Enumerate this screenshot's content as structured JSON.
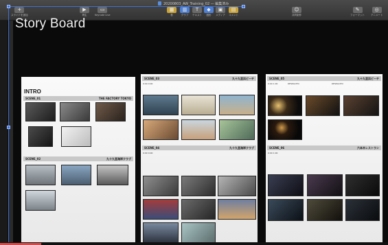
{
  "window": {
    "title": "20200803_AW_Training_02 — 編集済み"
  },
  "toolbar": {
    "left": [
      {
        "id": "view",
        "label": "スライドを追加"
      },
      {
        "id": "play",
        "label": "再生"
      },
      {
        "id": "keynote-live",
        "label": "Keynote Live"
      }
    ],
    "center": [
      {
        "id": "table",
        "label": "表"
      },
      {
        "id": "chart",
        "label": "グラフ"
      },
      {
        "id": "text",
        "label": "テキスト"
      },
      {
        "id": "shape",
        "label": "図形"
      },
      {
        "id": "media",
        "label": "メディア"
      },
      {
        "id": "comment",
        "label": "コメント"
      }
    ],
    "right": [
      {
        "id": "collab",
        "label": "共同制作"
      },
      {
        "id": "format",
        "label": "フォーマット"
      },
      {
        "id": "animate",
        "label": "アニメート"
      }
    ]
  },
  "slide": {
    "title": "Story Board",
    "boards": [
      {
        "id": "board-1",
        "heading": "INTRO",
        "scenes": [
          {
            "id": "scene-01",
            "label": "SCENE_01",
            "location": "THE FACTORY TOKYO"
          },
          {
            "id": "scene-02",
            "label": "SCENE_02",
            "location": "九十九里海岸クラブ"
          }
        ]
      },
      {
        "id": "board-2",
        "scenes": [
          {
            "id": "scene-03",
            "label": "SCENE_03",
            "location": "九十九里浜ビーチ",
            "meta": "0:00  0:00"
          },
          {
            "id": "scene-04",
            "label": "SCENE_04",
            "location": "九十九里海岸クラブ",
            "meta": "0:00  0:00"
          }
        ]
      },
      {
        "id": "board-3",
        "scenes": [
          {
            "id": "scene-05",
            "label": "SCENE_05",
            "location": "九十九里浜ビーチ",
            "meta": "0:00  1:00",
            "col1": "DESPACITO",
            "col2": "DESPACITO"
          },
          {
            "id": "scene-06",
            "label": "SCENE_06",
            "location": "六本木レストラン",
            "meta": "0:00  1:00"
          }
        ]
      }
    ]
  }
}
